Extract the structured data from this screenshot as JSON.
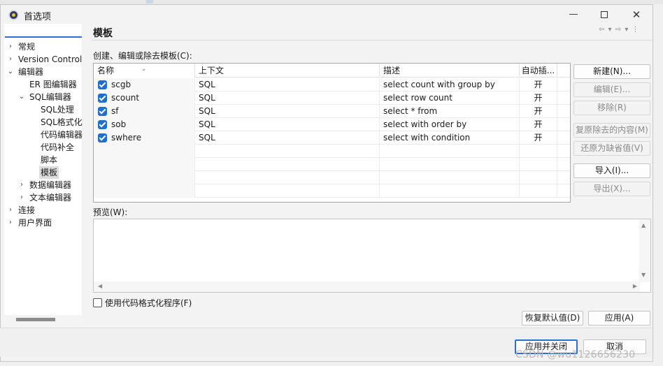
{
  "window": {
    "title": "首选项",
    "min_glyph": "—",
    "close_glyph": "✕"
  },
  "filter": {
    "value": ""
  },
  "tree": [
    {
      "label": "常规",
      "level": 0,
      "chevron": "›"
    },
    {
      "label": "Version Control",
      "level": 0,
      "chevron": "›"
    },
    {
      "label": "编辑器",
      "level": 0,
      "chevron": "⌄"
    },
    {
      "label": "ER 图编辑器",
      "level": 1,
      "chevron": ""
    },
    {
      "label": "SQL编辑器",
      "level": 1,
      "chevron": "⌄"
    },
    {
      "label": "SQL处理",
      "level": 2,
      "chevron": ""
    },
    {
      "label": "SQL格式化",
      "level": 2,
      "chevron": ""
    },
    {
      "label": "代码编辑器",
      "level": 2,
      "chevron": ""
    },
    {
      "label": "代码补全",
      "level": 2,
      "chevron": ""
    },
    {
      "label": "脚本",
      "level": 2,
      "chevron": ""
    },
    {
      "label": "模板",
      "level": 2,
      "chevron": "",
      "selected": true
    },
    {
      "label": "数据编辑器",
      "level": 1,
      "chevron": "›"
    },
    {
      "label": "文本编辑器",
      "level": 1,
      "chevron": "›"
    },
    {
      "label": "连接",
      "level": 0,
      "chevron": "›"
    },
    {
      "label": "用户界面",
      "level": 0,
      "chevron": "›"
    }
  ],
  "page": {
    "title": "模板",
    "nav_arrows": "⇦ ▾ ⇨ ▾ ⋮",
    "section_label": "创建、编辑或除去模板(C):",
    "preview_label": "预览(W):",
    "format_checkbox_label": "使用代码格式化程序(F)"
  },
  "table": {
    "columns": [
      "名称",
      "上下文",
      "描述",
      "自动插..."
    ],
    "sort_indicator": "⌄",
    "rows": [
      {
        "name": "scgb",
        "context": "SQL",
        "description": "select count with group by",
        "auto": "开",
        "checked": true
      },
      {
        "name": "scount",
        "context": "SQL",
        "description": "select row count",
        "auto": "开",
        "checked": true
      },
      {
        "name": "sf",
        "context": "SQL",
        "description": "select * from",
        "auto": "开",
        "checked": true
      },
      {
        "name": "sob",
        "context": "SQL",
        "description": "select with order by",
        "auto": "开",
        "checked": true
      },
      {
        "name": "swhere",
        "context": "SQL",
        "description": "select with condition",
        "auto": "开",
        "checked": true
      }
    ]
  },
  "buttons": {
    "new": "新建(N)...",
    "edit": "编辑(E)...",
    "remove": "移除(R)",
    "restore_removed": "复原除去的内容(M)",
    "revert_default": "还原为缺省值(V)",
    "import": "导入(I)...",
    "export": "导出(X)...",
    "restore_defaults": "恢复默认值(D)",
    "apply": "应用(A)",
    "apply_close": "应用并关闭",
    "cancel": "取消"
  },
  "scroll_glyphs": {
    "up": "▲",
    "down": "▼",
    "left": "◀",
    "right": "▶"
  },
  "watermark": "CSDN @wu1126656230"
}
